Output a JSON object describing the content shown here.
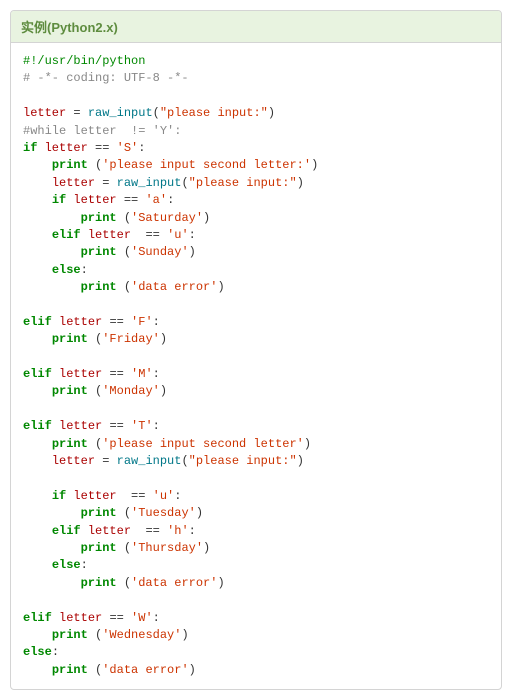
{
  "header": {
    "title": "实例(Python2.x)"
  },
  "code": {
    "shebang": "#!/usr/bin/python",
    "coding": "# -*- coding: UTF-8 -*-",
    "var": "letter",
    "assign": "=",
    "fn_input": "raw_input",
    "fn_print": "print",
    "prompt": "\"please input:\"",
    "while_comment": "#while letter  != 'Y':",
    "kw_if": "if",
    "kw_elif": "elif",
    "kw_else": "else",
    "eq": "==",
    "colon": ":",
    "lit_S": "'S'",
    "lit_a": "'a'",
    "lit_u": "'u'",
    "lit_h": "'h'",
    "lit_F": "'F'",
    "lit_M": "'M'",
    "lit_T": "'T'",
    "lit_W": "'W'",
    "msg_second": "'please input second letter:'",
    "msg_second2": "'please input second letter'",
    "msg_sat": "'Saturday'",
    "msg_sun": "'Sunday'",
    "msg_fri": "'Friday'",
    "msg_mon": "'Monday'",
    "msg_tue": "'Tuesday'",
    "msg_thu": "'Thursday'",
    "msg_wed": "'Wednesday'",
    "msg_err": "'data error'",
    "lp": "(",
    "rp": ")"
  }
}
